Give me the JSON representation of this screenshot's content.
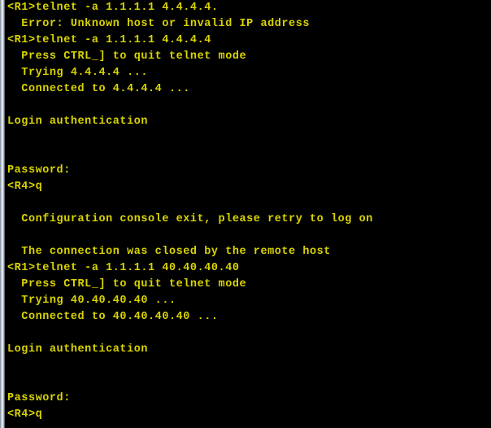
{
  "terminal": {
    "background_color": "#000000",
    "text_color": "#d9d400",
    "gutter_color": "#dfe6ec",
    "lines": [
      "<R1>telnet -a 1.1.1.1 4.4.4.4.",
      "  Error: Unknown host or invalid IP address",
      "<R1>telnet -a 1.1.1.1 4.4.4.4",
      "  Press CTRL_] to quit telnet mode",
      "  Trying 4.4.4.4 ...",
      "  Connected to 4.4.4.4 ...",
      "",
      "Login authentication",
      "",
      "",
      "Password:",
      "<R4>q",
      "",
      "  Configuration console exit, please retry to log on",
      "",
      "  The connection was closed by the remote host",
      "<R1>telnet -a 1.1.1.1 40.40.40.40",
      "  Press CTRL_] to quit telnet mode",
      "  Trying 40.40.40.40 ...",
      "  Connected to 40.40.40.40 ...",
      "",
      "Login authentication",
      "",
      "",
      "Password:",
      "<R4>q"
    ]
  }
}
